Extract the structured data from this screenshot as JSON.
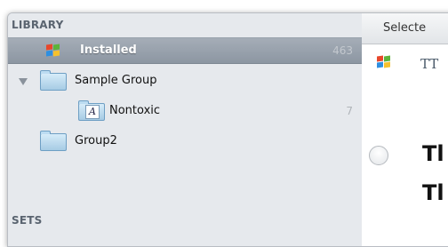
{
  "sidebar": {
    "library_header": "LIBRARY",
    "sets_header": "SETS",
    "items": [
      {
        "label": "Installed",
        "count": "463",
        "selected": true
      },
      {
        "label": "Sample Group",
        "count": ""
      },
      {
        "label": "Nontoxic",
        "count": "7"
      },
      {
        "label": "Group2",
        "count": ""
      }
    ]
  },
  "right_pane": {
    "header_label": "Selecte",
    "type_glyph": "TT",
    "preview_line1": "Tl",
    "preview_line2": "Tl"
  },
  "colors": {
    "selection": "#97a0ab",
    "sidebar_bg": "#e6e9ed",
    "folder": "#a6cbe4"
  },
  "icons": [
    "windows-logo-icon",
    "disclosure-triangle-icon",
    "folder-icon",
    "font-folder-icon",
    "font-type-icon",
    "radio-icon"
  ]
}
